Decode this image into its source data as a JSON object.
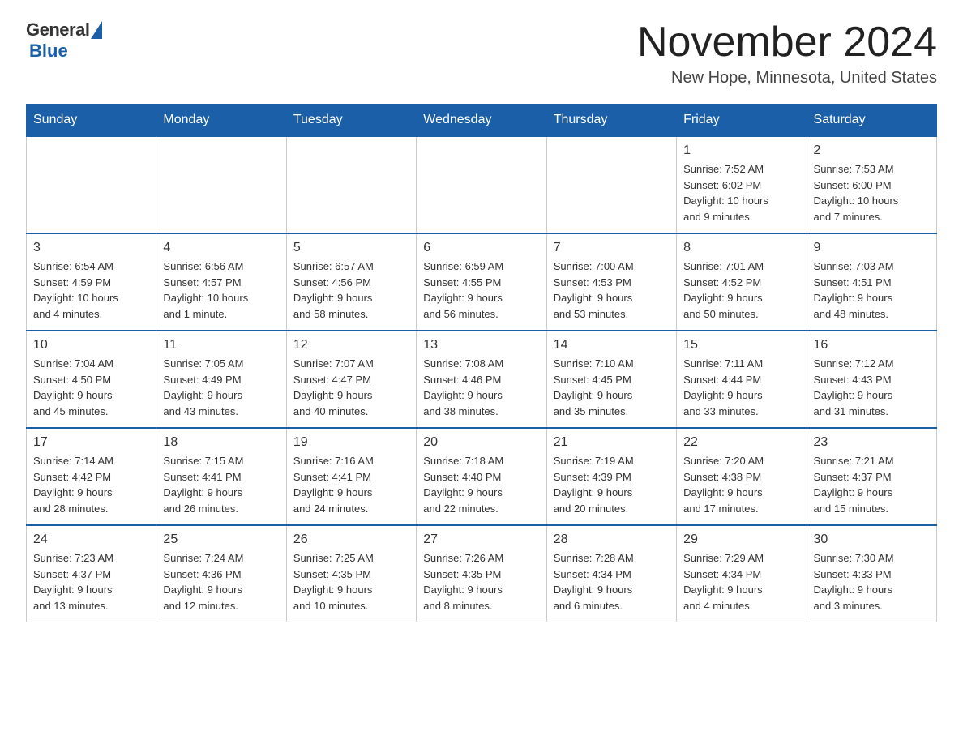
{
  "header": {
    "logo_general": "General",
    "logo_blue": "Blue",
    "month_title": "November 2024",
    "location": "New Hope, Minnesota, United States"
  },
  "calendar": {
    "days_of_week": [
      "Sunday",
      "Monday",
      "Tuesday",
      "Wednesday",
      "Thursday",
      "Friday",
      "Saturday"
    ],
    "weeks": [
      [
        {
          "day": "",
          "info": "",
          "empty": true
        },
        {
          "day": "",
          "info": "",
          "empty": true
        },
        {
          "day": "",
          "info": "",
          "empty": true
        },
        {
          "day": "",
          "info": "",
          "empty": true
        },
        {
          "day": "",
          "info": "",
          "empty": true
        },
        {
          "day": "1",
          "info": "Sunrise: 7:52 AM\nSunset: 6:02 PM\nDaylight: 10 hours\nand 9 minutes."
        },
        {
          "day": "2",
          "info": "Sunrise: 7:53 AM\nSunset: 6:00 PM\nDaylight: 10 hours\nand 7 minutes."
        }
      ],
      [
        {
          "day": "3",
          "info": "Sunrise: 6:54 AM\nSunset: 4:59 PM\nDaylight: 10 hours\nand 4 minutes."
        },
        {
          "day": "4",
          "info": "Sunrise: 6:56 AM\nSunset: 4:57 PM\nDaylight: 10 hours\nand 1 minute."
        },
        {
          "day": "5",
          "info": "Sunrise: 6:57 AM\nSunset: 4:56 PM\nDaylight: 9 hours\nand 58 minutes."
        },
        {
          "day": "6",
          "info": "Sunrise: 6:59 AM\nSunset: 4:55 PM\nDaylight: 9 hours\nand 56 minutes."
        },
        {
          "day": "7",
          "info": "Sunrise: 7:00 AM\nSunset: 4:53 PM\nDaylight: 9 hours\nand 53 minutes."
        },
        {
          "day": "8",
          "info": "Sunrise: 7:01 AM\nSunset: 4:52 PM\nDaylight: 9 hours\nand 50 minutes."
        },
        {
          "day": "9",
          "info": "Sunrise: 7:03 AM\nSunset: 4:51 PM\nDaylight: 9 hours\nand 48 minutes."
        }
      ],
      [
        {
          "day": "10",
          "info": "Sunrise: 7:04 AM\nSunset: 4:50 PM\nDaylight: 9 hours\nand 45 minutes."
        },
        {
          "day": "11",
          "info": "Sunrise: 7:05 AM\nSunset: 4:49 PM\nDaylight: 9 hours\nand 43 minutes."
        },
        {
          "day": "12",
          "info": "Sunrise: 7:07 AM\nSunset: 4:47 PM\nDaylight: 9 hours\nand 40 minutes."
        },
        {
          "day": "13",
          "info": "Sunrise: 7:08 AM\nSunset: 4:46 PM\nDaylight: 9 hours\nand 38 minutes."
        },
        {
          "day": "14",
          "info": "Sunrise: 7:10 AM\nSunset: 4:45 PM\nDaylight: 9 hours\nand 35 minutes."
        },
        {
          "day": "15",
          "info": "Sunrise: 7:11 AM\nSunset: 4:44 PM\nDaylight: 9 hours\nand 33 minutes."
        },
        {
          "day": "16",
          "info": "Sunrise: 7:12 AM\nSunset: 4:43 PM\nDaylight: 9 hours\nand 31 minutes."
        }
      ],
      [
        {
          "day": "17",
          "info": "Sunrise: 7:14 AM\nSunset: 4:42 PM\nDaylight: 9 hours\nand 28 minutes."
        },
        {
          "day": "18",
          "info": "Sunrise: 7:15 AM\nSunset: 4:41 PM\nDaylight: 9 hours\nand 26 minutes."
        },
        {
          "day": "19",
          "info": "Sunrise: 7:16 AM\nSunset: 4:41 PM\nDaylight: 9 hours\nand 24 minutes."
        },
        {
          "day": "20",
          "info": "Sunrise: 7:18 AM\nSunset: 4:40 PM\nDaylight: 9 hours\nand 22 minutes."
        },
        {
          "day": "21",
          "info": "Sunrise: 7:19 AM\nSunset: 4:39 PM\nDaylight: 9 hours\nand 20 minutes."
        },
        {
          "day": "22",
          "info": "Sunrise: 7:20 AM\nSunset: 4:38 PM\nDaylight: 9 hours\nand 17 minutes."
        },
        {
          "day": "23",
          "info": "Sunrise: 7:21 AM\nSunset: 4:37 PM\nDaylight: 9 hours\nand 15 minutes."
        }
      ],
      [
        {
          "day": "24",
          "info": "Sunrise: 7:23 AM\nSunset: 4:37 PM\nDaylight: 9 hours\nand 13 minutes."
        },
        {
          "day": "25",
          "info": "Sunrise: 7:24 AM\nSunset: 4:36 PM\nDaylight: 9 hours\nand 12 minutes."
        },
        {
          "day": "26",
          "info": "Sunrise: 7:25 AM\nSunset: 4:35 PM\nDaylight: 9 hours\nand 10 minutes."
        },
        {
          "day": "27",
          "info": "Sunrise: 7:26 AM\nSunset: 4:35 PM\nDaylight: 9 hours\nand 8 minutes."
        },
        {
          "day": "28",
          "info": "Sunrise: 7:28 AM\nSunset: 4:34 PM\nDaylight: 9 hours\nand 6 minutes."
        },
        {
          "day": "29",
          "info": "Sunrise: 7:29 AM\nSunset: 4:34 PM\nDaylight: 9 hours\nand 4 minutes."
        },
        {
          "day": "30",
          "info": "Sunrise: 7:30 AM\nSunset: 4:33 PM\nDaylight: 9 hours\nand 3 minutes."
        }
      ]
    ]
  }
}
